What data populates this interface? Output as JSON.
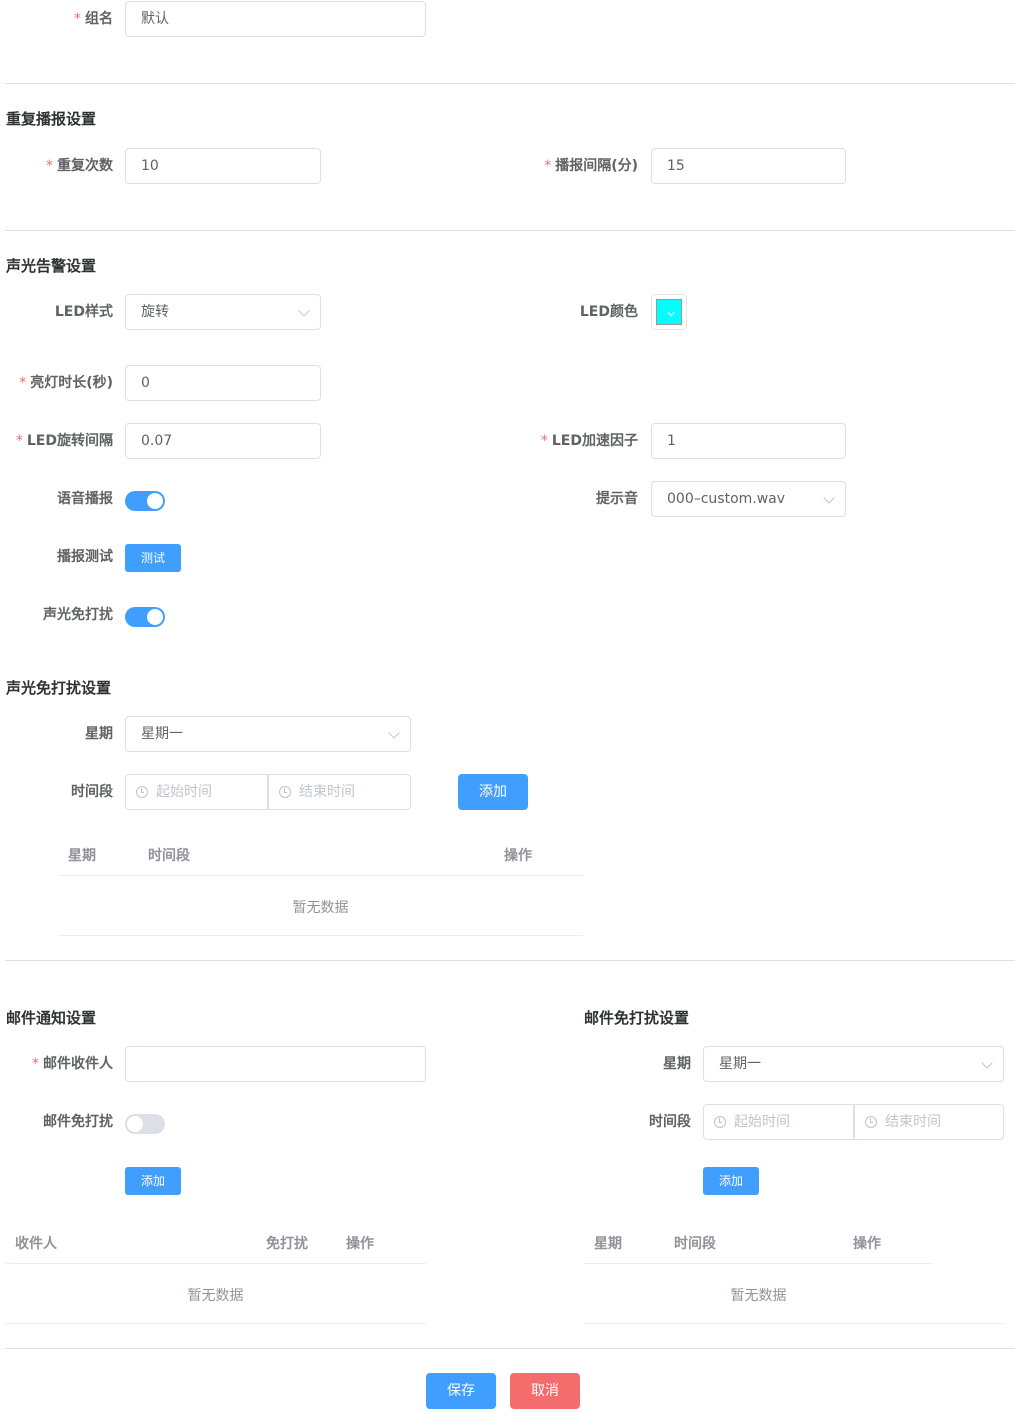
{
  "group": {
    "label": "组名",
    "value": "默认"
  },
  "repeat": {
    "title": "重复播报设置",
    "count_label": "重复次数",
    "count_value": "10",
    "interval_label": "播报间隔(分)",
    "interval_value": "15"
  },
  "alarm": {
    "title": "声光告警设置",
    "led_style_label": "LED样式",
    "led_style_value": "旋转",
    "led_color_label": "LED颜色",
    "led_color": "#00ffff",
    "light_duration_label": "亮灯时长(秒)",
    "light_duration_value": "0",
    "rotate_interval_label": "LED旋转间隔",
    "rotate_interval_value": "0.07",
    "accel_label": "LED加速因子",
    "accel_value": "1",
    "voice_label": "语音播报",
    "voice_on": true,
    "sound_label": "提示音",
    "sound_value": "000–custom.wav",
    "test_label": "播报测试",
    "test_button": "测试",
    "dnd_label": "声光免打扰",
    "dnd_on": true
  },
  "alarm_dnd": {
    "title": "声光免打扰设置",
    "weekday_label": "星期",
    "weekday_value": "星期一",
    "period_label": "时间段",
    "start_placeholder": "起始时间",
    "end_placeholder": "结束时间",
    "add_button": "添加",
    "table": {
      "headers": [
        "星期",
        "时间段",
        "操作"
      ],
      "empty": "暂无数据"
    }
  },
  "mail": {
    "title": "邮件通知设置",
    "recipient_label": "邮件收件人",
    "recipient_value": "",
    "dnd_label": "邮件免打扰",
    "dnd_on": false,
    "add_button": "添加",
    "table": {
      "headers": [
        "收件人",
        "免打扰",
        "操作"
      ],
      "empty": "暂无数据"
    }
  },
  "mail_dnd": {
    "title": "邮件免打扰设置",
    "weekday_label": "星期",
    "weekday_value": "星期一",
    "period_label": "时间段",
    "start_placeholder": "起始时间",
    "end_placeholder": "结束时间",
    "add_button": "添加",
    "table": {
      "headers": [
        "星期",
        "时间段",
        "操作"
      ],
      "empty": "暂无数据"
    }
  },
  "footer": {
    "save_button": "保存",
    "cancel_button": "取消"
  },
  "colors": {
    "primary": "#409eff",
    "danger": "#f56c6c",
    "required": "#f56c6c"
  }
}
